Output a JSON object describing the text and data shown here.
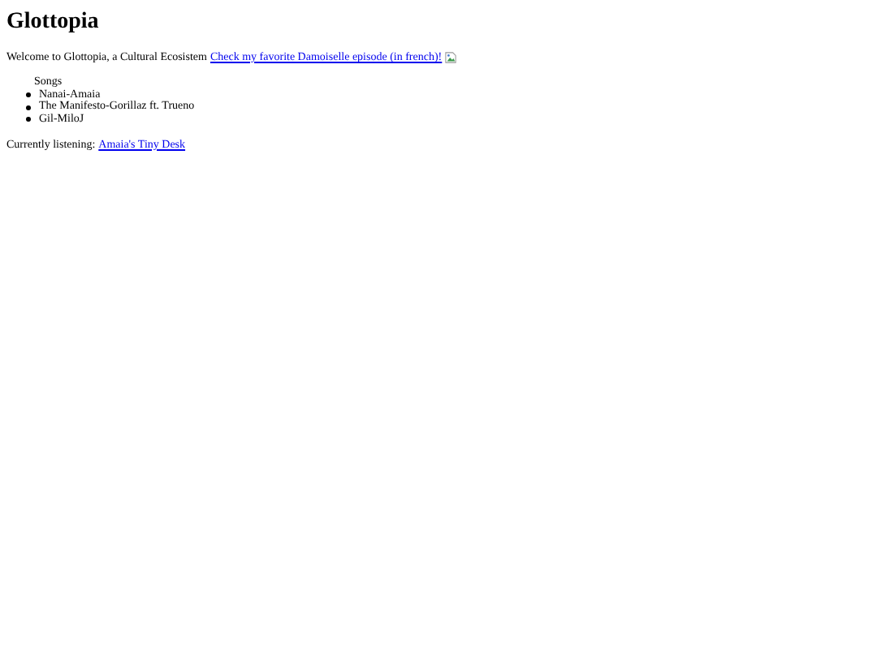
{
  "title": "Glottopia",
  "intro": {
    "text": "Welcome to Glottopia, a Cultural Ecosistem",
    "link": "Check my favorite Damoiselle episode (in french)!"
  },
  "songs": {
    "heading": "Songs",
    "items": [
      "Nanai-Amaia",
      "The Manifesto-Gorillaz ft. Trueno",
      "Gil-MiloJ"
    ]
  },
  "listening": {
    "label": "Currently listening:",
    "link": "Amaia's Tiny Desk"
  }
}
